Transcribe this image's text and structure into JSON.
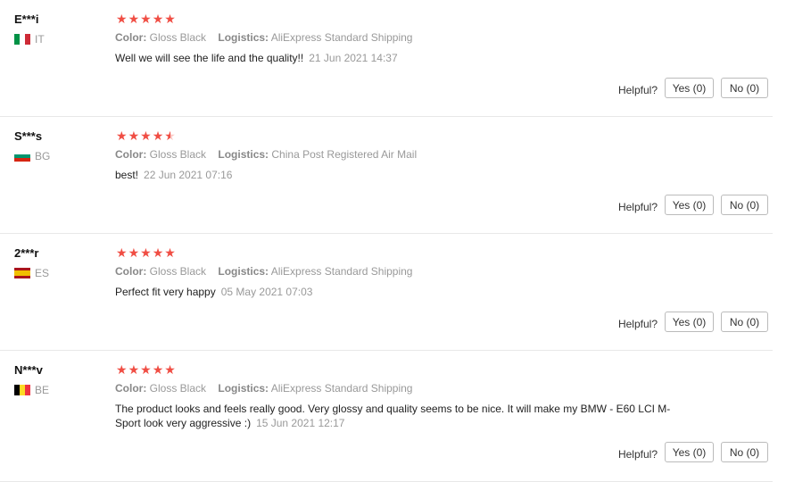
{
  "labels": {
    "color": "Color:",
    "logistics": "Logistics:",
    "helpful": "Helpful?"
  },
  "reviews": [
    {
      "user": "E***i",
      "country": "IT",
      "flag_colors": [
        "#009246",
        "#ffffff",
        "#ce2b37"
      ],
      "rating": 5,
      "color": "Gloss Black",
      "logistics": "AliExpress Standard Shipping",
      "text": "Well we will see the life and the quality!!",
      "date": "21 Jun 2021 14:37",
      "yes": "Yes (0)",
      "no": "No (0)"
    },
    {
      "user": "S***s",
      "country": "BG",
      "flag_colors": [
        "#ffffff",
        "#00966e",
        "#d62612"
      ],
      "rating": 4.5,
      "color": "Gloss Black",
      "logistics": "China Post Registered Air Mail",
      "text": "best!",
      "date": "22 Jun 2021 07:16",
      "yes": "Yes (0)",
      "no": "No (0)"
    },
    {
      "user": "2***r",
      "country": "ES",
      "flag_colors": [
        "#aa151b",
        "#f1bf00",
        "#aa151b"
      ],
      "rating": 5,
      "color": "Gloss Black",
      "logistics": "AliExpress Standard Shipping",
      "text": "Perfect fit very happy",
      "date": "05 May 2021 07:03",
      "yes": "Yes (0)",
      "no": "No (0)"
    },
    {
      "user": "N***v",
      "country": "BE",
      "flag_colors": [
        "#000000",
        "#fdda24",
        "#ef3340"
      ],
      "rating": 5,
      "color": "Gloss Black",
      "logistics": "AliExpress Standard Shipping",
      "text": "The product looks and feels really good. Very glossy and quality seems to be nice. It will make my BMW - E60 LCI M-Sport look very aggressive :)",
      "date": "15 Jun 2021 12:17",
      "yes": "Yes (0)",
      "no": "No (0)"
    }
  ],
  "accent": "#f04e44"
}
